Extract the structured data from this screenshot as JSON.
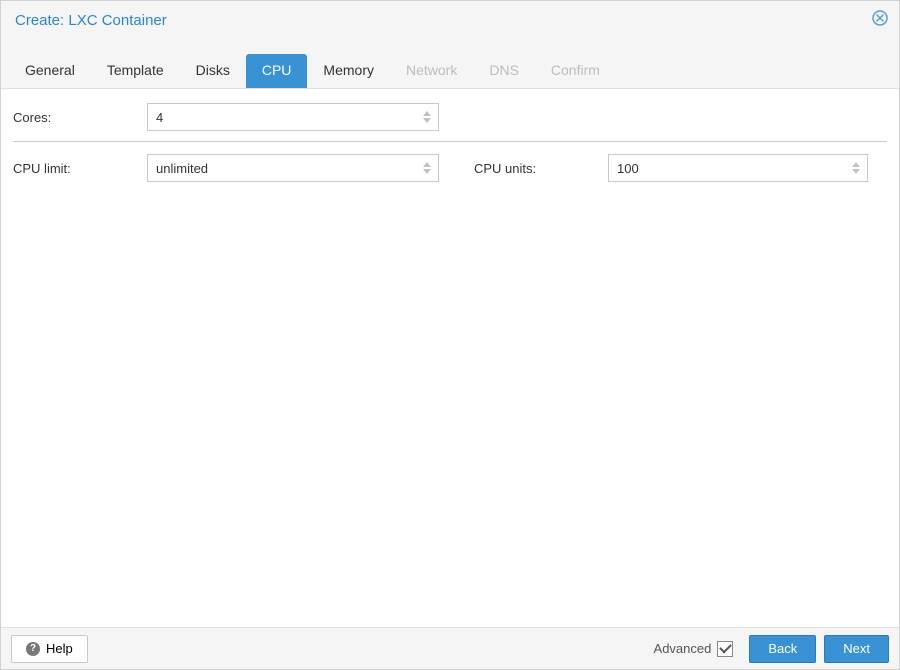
{
  "header": {
    "title": "Create: LXC Container"
  },
  "tabs": [
    {
      "label": "General",
      "active": false,
      "disabled": false
    },
    {
      "label": "Template",
      "active": false,
      "disabled": false
    },
    {
      "label": "Disks",
      "active": false,
      "disabled": false
    },
    {
      "label": "CPU",
      "active": true,
      "disabled": false
    },
    {
      "label": "Memory",
      "active": false,
      "disabled": false
    },
    {
      "label": "Network",
      "active": false,
      "disabled": true
    },
    {
      "label": "DNS",
      "active": false,
      "disabled": true
    },
    {
      "label": "Confirm",
      "active": false,
      "disabled": true
    }
  ],
  "form": {
    "cores": {
      "label": "Cores:",
      "value": "4"
    },
    "cpu_limit": {
      "label": "CPU limit:",
      "value": "unlimited"
    },
    "cpu_units": {
      "label": "CPU units:",
      "value": "100"
    }
  },
  "footer": {
    "help": "Help",
    "advanced": "Advanced",
    "advanced_checked": true,
    "back": "Back",
    "next": "Next"
  },
  "colors": {
    "accent": "#3892d4",
    "link": "#2b85d0"
  }
}
